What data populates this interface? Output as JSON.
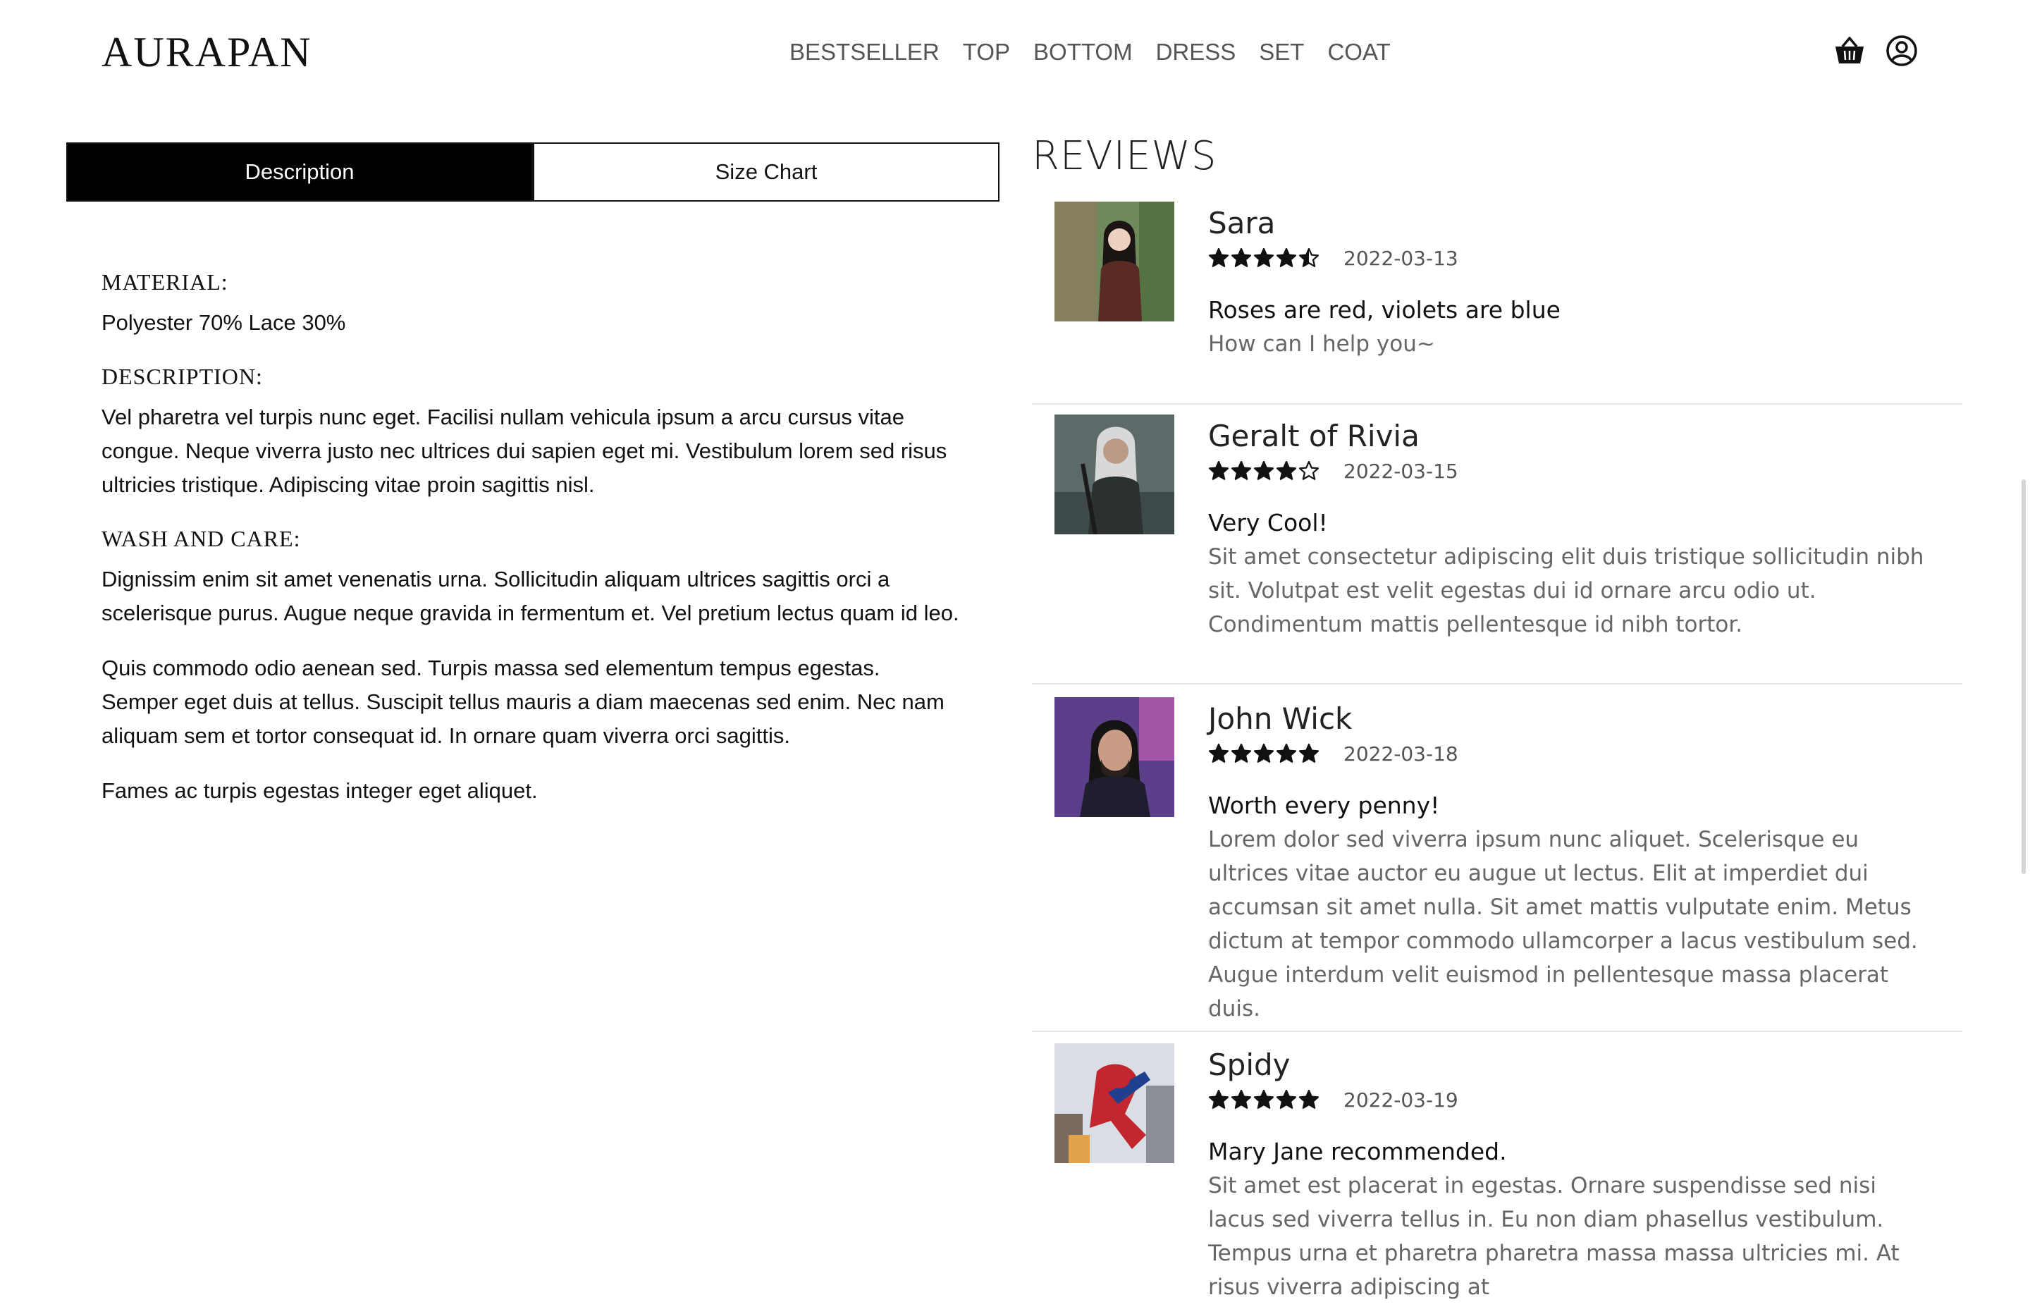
{
  "header": {
    "logo": "AURAPAN",
    "nav": [
      "BESTSELLER",
      "TOP",
      "BOTTOM",
      "DRESS",
      "SET",
      "COAT"
    ],
    "icons": [
      "basket-icon",
      "account-icon"
    ]
  },
  "tabs": {
    "description": "Description",
    "size_chart": "Size Chart",
    "active": "Description"
  },
  "description": {
    "material_title": "MATERIAL:",
    "material_text": "Polyester 70% Lace 30%",
    "description_title": "DESCRIPTION:",
    "description_text": "Vel pharetra vel turpis nunc eget. Facilisi nullam vehicula ipsum a arcu cursus vitae congue. Neque viverra justo nec ultrices dui sapien eget mi. Vestibulum lorem sed risus ultricies tristique. Adipiscing vitae proin sagittis nisl.",
    "wash_title": "WASH AND CARE:",
    "wash_paragraphs": [
      "Dignissim enim sit amet venenatis urna. Sollicitudin aliquam ultrices sagittis orci a scelerisque purus. Augue neque gravida in fermentum et. Vel pretium lectus quam id leo.",
      "Quis commodo odio aenean sed. Turpis massa sed elementum tempus egestas. Semper eget duis at tellus. Suscipit tellus mauris a diam maecenas sed enim. Nec nam aliquam sem et tortor consequat id. In ornare quam viverra orci sagittis.",
      "Fames ac turpis egestas integer eget aliquet."
    ]
  },
  "reviews": {
    "title": "REVIEWS",
    "items": [
      {
        "name": "Sara",
        "rating": 4.5,
        "date": "2022-03-13",
        "title": "Roses are red, violets are blue",
        "text": "How can I help you~",
        "avatar_colors": [
          "#6f8a5a",
          "#5a2a24"
        ]
      },
      {
        "name": "Geralt of Rivia",
        "rating": 4,
        "date": "2022-03-15",
        "title": "Very Cool!",
        "text": "Sit amet consectetur adipiscing elit duis tristique sollicitudin nibh sit. Volutpat est velit egestas dui id ornare arcu odio ut. Condimentum mattis pellentesque id nibh tortor.",
        "avatar_colors": [
          "#5d6a6a",
          "#2b3030"
        ]
      },
      {
        "name": "John Wick",
        "rating": 5,
        "date": "2022-03-18",
        "title": "Worth every penny!",
        "text": "Lorem dolor sed viverra ipsum nunc aliquet. Scelerisque eu ultrices vitae auctor eu augue ut lectus. Elit at imperdiet dui accumsan sit amet nulla. Sit amet mattis vulputate enim. Metus dictum at tempor commodo ullamcorper a lacus vestibulum sed. Augue interdum velit euismod in pellentesque massa placerat duis.",
        "avatar_colors": [
          "#5b3f8a",
          "#1e1e2e"
        ]
      },
      {
        "name": "Spidy",
        "rating": 5,
        "date": "2022-03-19",
        "title": "Mary Jane recommended.",
        "text": "Sit amet est placerat in egestas. Ornare suspendisse sed nisi lacus sed viverra tellus in. Eu non diam phasellus vestibulum. Tempus urna et pharetra pharetra massa massa ultricies mi. At risus viverra adipiscing at",
        "avatar_colors": [
          "#d9dde4",
          "#c2262e"
        ]
      }
    ]
  }
}
